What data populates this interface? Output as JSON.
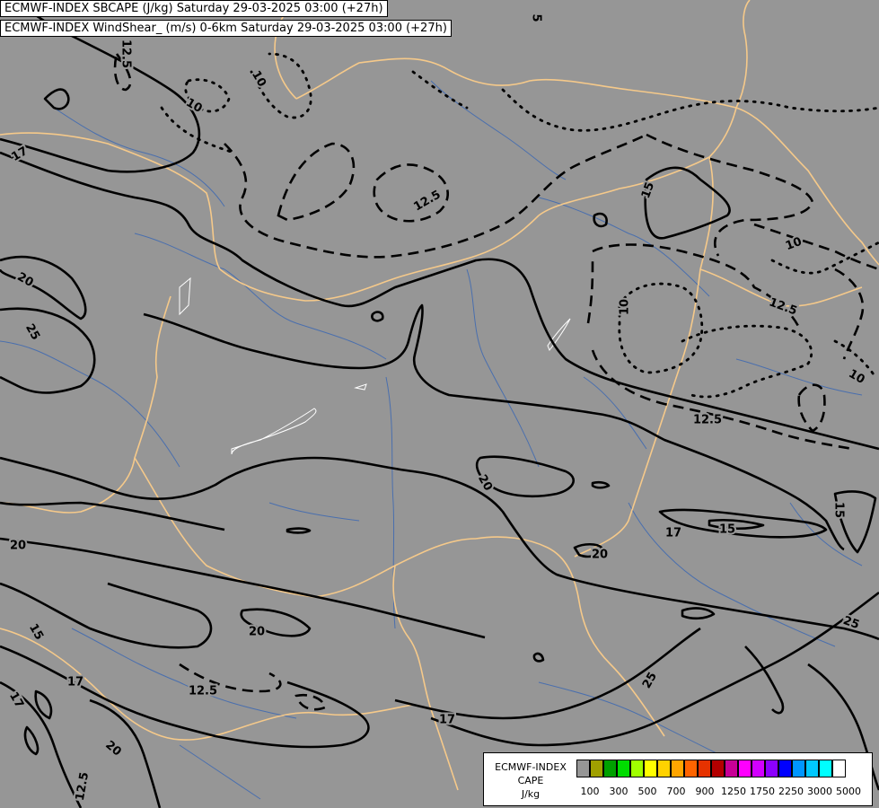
{
  "header": {
    "line1": "ECMWF-INDEX SBCAPE (J/kg) Saturday 29-03-2025 03:00 (+27h)",
    "line2": "ECMWF-INDEX WindShear_ (m/s) 0-6km Saturday 29-03-2025 03:00 (+27h)"
  },
  "legend": {
    "title_lines": [
      "ECMWF-INDEX",
      "CAPE",
      "J/kg"
    ],
    "colors": [
      "#969696",
      "#a0a000",
      "#00a000",
      "#00dc00",
      "#a0ff00",
      "#ffff00",
      "#ffd200",
      "#ffa500",
      "#ff6400",
      "#e63200",
      "#b40000",
      "#c80096",
      "#ff00ff",
      "#d200ff",
      "#8c00ff",
      "#0000ff",
      "#0096ff",
      "#00c8ff",
      "#00ffff",
      "#ffffff"
    ],
    "tick_labels": [
      "100",
      "300",
      "500",
      "700",
      "900",
      "1250",
      "1750",
      "2250",
      "3000",
      "5000"
    ]
  },
  "contour_labels": [
    "5",
    "12.5",
    "10",
    "10",
    "17",
    "12.5",
    "15",
    "10",
    "10",
    "20",
    "12.5",
    "25",
    "10",
    "12.5",
    "20",
    "17",
    "15",
    "20",
    "20",
    "20",
    "15",
    "17",
    "12.5",
    "17",
    "20",
    "17",
    "25",
    "25",
    "15",
    "12.5"
  ],
  "colors": {
    "background": "#969696",
    "borders": "#f5c98a",
    "rivers": "#4a6fae",
    "contours": "#000000"
  }
}
